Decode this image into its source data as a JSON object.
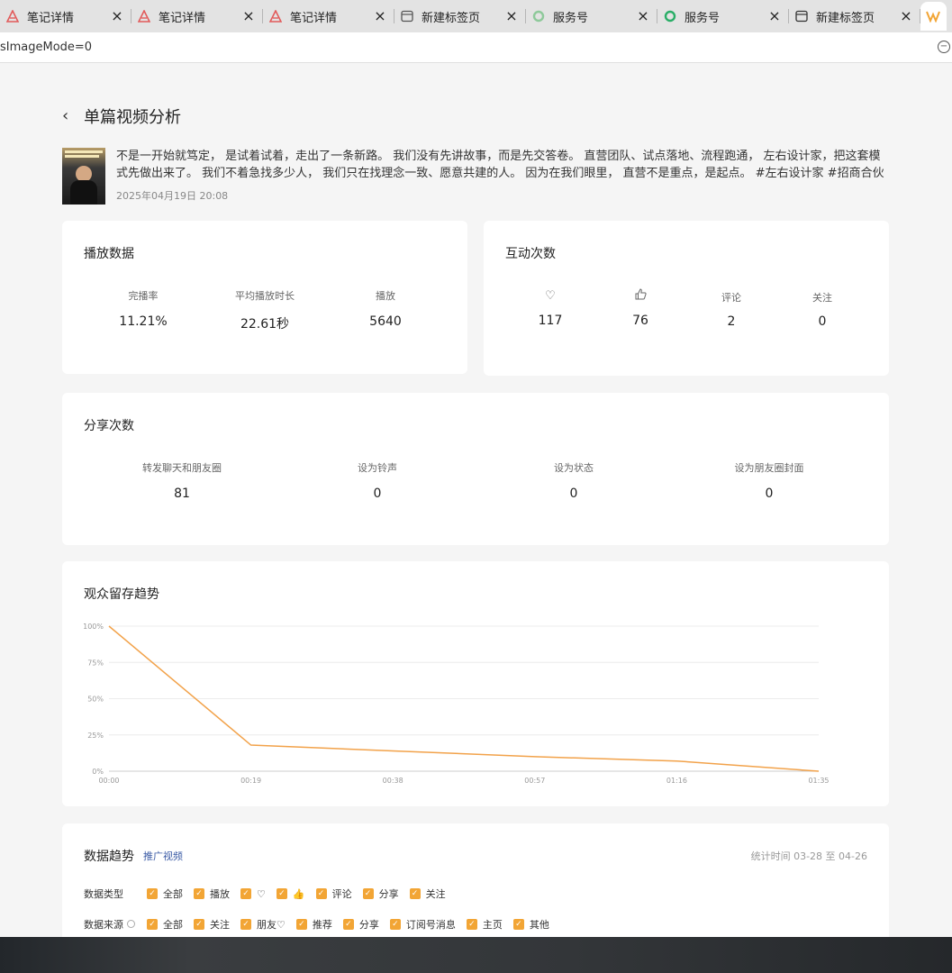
{
  "browser": {
    "tabs": [
      {
        "label": "笔记详情",
        "icon": "note-icon",
        "color": "#e25a5a"
      },
      {
        "label": "笔记详情",
        "icon": "note-icon",
        "color": "#e25a5a"
      },
      {
        "label": "笔记详情",
        "icon": "note-icon",
        "color": "#e25a5a"
      },
      {
        "label": "新建标签页",
        "icon": "newtab-icon",
        "color": "#555555"
      },
      {
        "label": "服务号",
        "icon": "service-icon",
        "color": "#8ec99a"
      },
      {
        "label": "服务号",
        "icon": "service-icon",
        "color": "#2aae67"
      },
      {
        "label": "新建标签页",
        "icon": "newtab-icon",
        "color": "#333333"
      }
    ],
    "close_glyph": "×",
    "url": "sImageMode=0",
    "zoom_glyph": "−"
  },
  "page": {
    "back_glyph": "‹",
    "title": "单篇视频分析",
    "video": {
      "description": "不是一开始就笃定， 是试着试着，走出了一条新路。 我们没有先讲故事，而是先交答卷。 直营团队、试点落地、流程跑通， 左右设计家，把这套模式先做出来了。 我们不着急找多少人， 我们只在找理念一致、愿意共建的人。 因为在我们眼里， 直营不是重点，是起点。 #左右设计家 #招商合伙人计划 ...",
      "date": "2025年04月19日 20:08"
    },
    "play_card": {
      "title": "播放数据",
      "stats": [
        {
          "label": "完播率",
          "value": "11.21%"
        },
        {
          "label": "平均播放时长",
          "value": "22.61秒"
        },
        {
          "label": "播放",
          "value": "5640"
        }
      ]
    },
    "interact_card": {
      "title": "互动次数",
      "stats": [
        {
          "icon": "♡",
          "label": "",
          "value": "117"
        },
        {
          "icon": "👍",
          "label": "",
          "value": "76"
        },
        {
          "icon": "",
          "label": "评论",
          "value": "2"
        },
        {
          "icon": "",
          "label": "关注",
          "value": "0"
        }
      ]
    },
    "share_card": {
      "title": "分享次数",
      "stats": [
        {
          "label": "转发聊天和朋友圈",
          "value": "81"
        },
        {
          "label": "设为铃声",
          "value": "0"
        },
        {
          "label": "设为状态",
          "value": "0"
        },
        {
          "label": "设为朋友圈封面",
          "value": "0"
        }
      ]
    },
    "retention_card": {
      "title": "观众留存趋势"
    },
    "trend_card": {
      "title": "数据趋势",
      "subtitle": "推广视频",
      "time_range": "统计时间 03-28 至 04-26",
      "type_label": "数据类型",
      "type_options": [
        "全部",
        "播放",
        "♡",
        "👍",
        "评论",
        "分享",
        "关注"
      ],
      "source_label": "数据来源",
      "source_options": [
        "全部",
        "关注",
        "朋友♡",
        "推荐",
        "分享",
        "订阅号消息",
        "主页",
        "其他"
      ],
      "check_glyph": "✓"
    }
  },
  "chart_data": {
    "type": "line",
    "title": "观众留存趋势",
    "x": [
      "00:00",
      "00:19",
      "00:38",
      "00:57",
      "01:16",
      "01:35"
    ],
    "values": [
      100,
      18,
      14,
      10,
      7,
      0
    ],
    "y_ticks": [
      "0%",
      "25%",
      "50%",
      "75%",
      "100%"
    ],
    "ylim": [
      0,
      100
    ],
    "grid": true,
    "color": "#f2a24a"
  }
}
